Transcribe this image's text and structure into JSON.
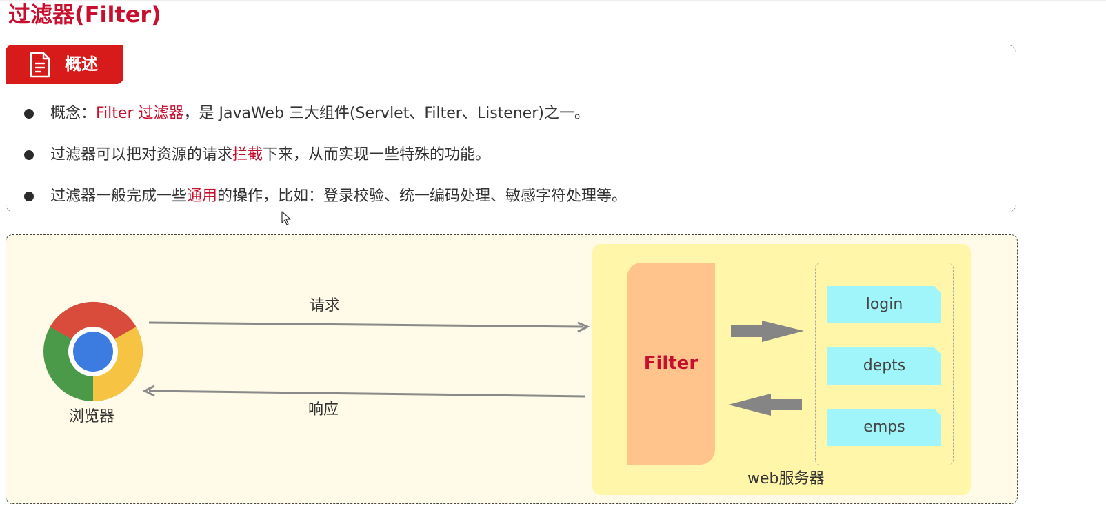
{
  "title": "过滤器(Filter)",
  "overview": {
    "tab_label": "概述",
    "bullets": [
      {
        "parts": [
          "概念：",
          "Filter 过滤器",
          "，是 JavaWeb 三大组件(Servlet、Filter、Listener)之一。"
        ]
      },
      {
        "parts": [
          "过滤器可以把对资源的请求",
          "拦截",
          "下来，从而实现一些特殊的功能。"
        ]
      },
      {
        "parts": [
          "过滤器一般完成一些",
          "通用",
          "的操作，比如：登录校验、统一编码处理、敏感字符处理等。"
        ]
      }
    ]
  },
  "diagram": {
    "browser_label": "浏览器",
    "request_label": "请求",
    "response_label": "响应",
    "filter_label": "Filter",
    "server_label": "web服务器",
    "resources": [
      "login",
      "depts",
      "emps"
    ]
  },
  "colors": {
    "accent_red": "#c8102e",
    "tab_red": "#d71a1a",
    "diagram_bg": "#fffbe8",
    "server_bg": "#fff59d",
    "filter_bg": "#ffc48c",
    "resource_bg": "#a0f5fa",
    "arrow_gray": "#888888"
  },
  "icons": [
    "document-icon",
    "chrome-icon",
    "cursor-icon"
  ]
}
